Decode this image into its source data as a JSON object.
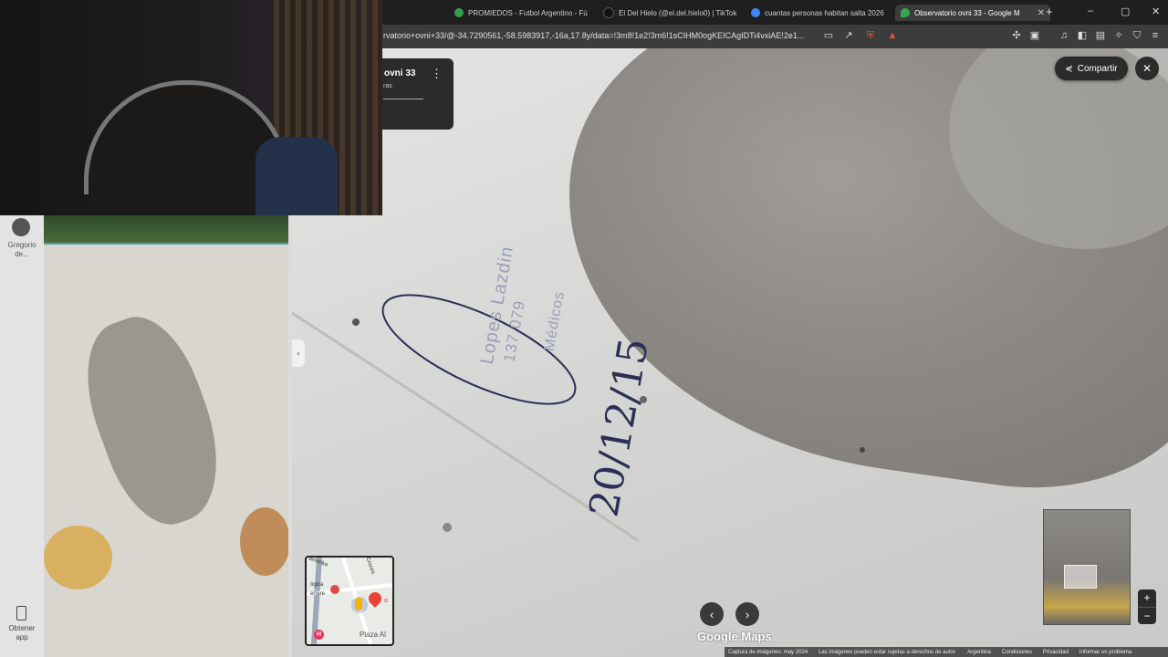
{
  "tabs": [
    {
      "title": "PROMIEDOS - Futbol Argentino - Fú",
      "icon": "promiedos-icon",
      "color": "#35a04a"
    },
    {
      "title": "El Del Hielo (@el.del.hielo0) | TikTok",
      "icon": "tiktok-icon",
      "color": "#111111"
    },
    {
      "title": "cuantas personas habitan salta 2026",
      "icon": "google-icon",
      "color": "#4285f4"
    },
    {
      "title": "Observatorio ovni 33 - Google M",
      "icon": "maps-pin-icon",
      "color": "#34a853"
    }
  ],
  "new_tab": "+",
  "window_controls": {
    "minimize": "–",
    "restore": "▢",
    "close": "✕"
  },
  "address_bar": {
    "url": "rvatorio+ovni+33/@-34.7290561,-58.5983917,-16a,17.8y/data=!3m8!1e2!3m6!1sCIHM0ogKEICAgIDTi4vxiAE!2e1..."
  },
  "place_card": {
    "title": "ovni 33",
    "subtitle": "ras",
    "menu": "⋮"
  },
  "share_button": {
    "label": "Compartir"
  },
  "close_button": {
    "label": "✕"
  },
  "left_sidebar": {
    "contributor": "Gregorio de...",
    "get_app": "Obtener app"
  },
  "minimap": {
    "labels": [
      "amerika",
      "ógica",
      "errere",
      "Cruces",
      "Plaza Al",
      "o"
    ]
  },
  "nav": {
    "prev": "‹",
    "next": "›"
  },
  "logo": "Google Maps",
  "footer": {
    "items": [
      "Captura de imágenes: may 2024",
      "Las imágenes pueden estar sujetas a derechos de autor.",
      "Argentina",
      "Condiciones",
      "Privacidad",
      "Informar un problema"
    ]
  },
  "zoom": {
    "in": "+",
    "out": "−"
  },
  "handwriting": {
    "date": "20/12/15",
    "stamp_name": "Lopes Lazdin",
    "stamp_number": "137.079",
    "stamp_role": "Médicos"
  },
  "colors": {
    "tabbar": "#1f1f1f",
    "toolbar": "#3c3c3c",
    "accent_red": "#ea4335",
    "pin_green": "#34a853"
  }
}
